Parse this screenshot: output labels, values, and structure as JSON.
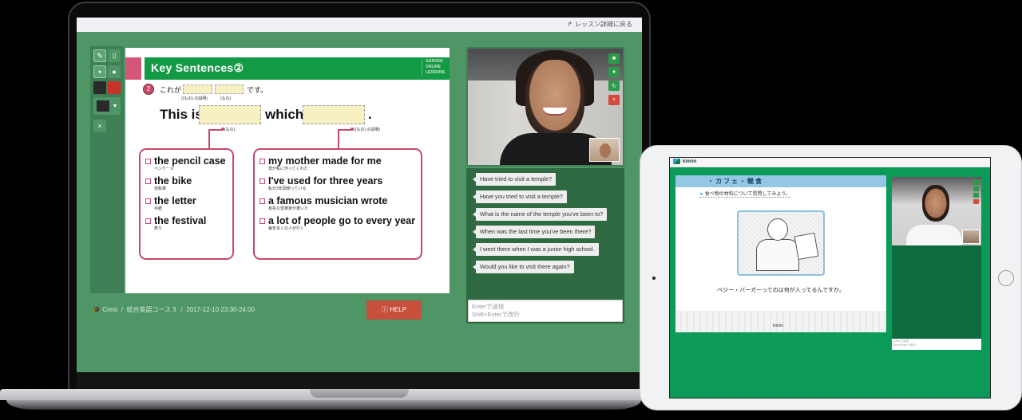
{
  "laptop": {
    "topbar": {
      "back_icon": "share-arrow-icon",
      "back_link": "レッスン詳細に戻る"
    },
    "palette": {
      "tools": [
        {
          "name": "pen",
          "icon": "pencil-icon",
          "active": true
        },
        {
          "name": "stamp",
          "icon": "stamp-icon",
          "active": false
        },
        {
          "name": "drop-small",
          "icon": "drop-small-icon",
          "active": true
        },
        {
          "name": "drop-large",
          "icon": "drop-large-icon",
          "active": false
        },
        {
          "name": "color-black",
          "color": "#2a2a2a"
        },
        {
          "name": "color-red",
          "color": "#c8322b"
        },
        {
          "name": "color-dropdown",
          "color": "#2a2a2a"
        },
        {
          "name": "clear",
          "icon": "close-icon",
          "label": "×"
        }
      ]
    },
    "slide": {
      "title": "Key Sentences②",
      "brand_logo": [
        "GAKKEN",
        "ONLINE",
        "LESSONS"
      ],
      "question_number": "2",
      "jp_prefix": "これが",
      "jp_suffix": "です。",
      "jp_hint_1": "((もの) の説明)",
      "jp_hint_2": "(もの)",
      "en_prefix": "This is",
      "en_middle": "which",
      "en_suffix": ".",
      "connector_hint_1": "(もの)",
      "connector_hint_2": "((もの) の説明)",
      "left_choices": [
        {
          "en": "the pencil case",
          "jp": "ペンケース"
        },
        {
          "en": "the bike",
          "jp": "自転車"
        },
        {
          "en": "the letter",
          "jp": "手紙"
        },
        {
          "en": "the festival",
          "jp": "祭り"
        }
      ],
      "right_choices": [
        {
          "en": "my mother made for me",
          "jp": "母が私に作ってくれた"
        },
        {
          "en": "I've used for three years",
          "jp": "私が3年間使っている"
        },
        {
          "en": "a famous musician wrote",
          "jp": "有名な音楽家が書いた"
        },
        {
          "en": "a lot of people go to every year",
          "jp": "毎年多くの人が行く"
        }
      ]
    },
    "breadcrumb": {
      "icon": "graduation-cap-icon",
      "items": [
        "Crest",
        "総合英語コース３",
        "2017-12-10 23:30-24:00"
      ],
      "separator": "/"
    },
    "help_button": {
      "icon": "info-circle-icon",
      "label": "HELP"
    },
    "video_controls": [
      {
        "name": "camera",
        "icon": "video-camera-icon",
        "color": "#2d9a4b"
      },
      {
        "name": "mic",
        "icon": "microphone-icon",
        "color": "#2d9a4b"
      },
      {
        "name": "switch",
        "icon": "refresh-icon",
        "color": "#2d9a4b"
      },
      {
        "name": "hangup",
        "icon": "close-icon",
        "color": "#d24b3c"
      }
    ],
    "chat": {
      "messages": [
        "Have tried to visit a temple?",
        "Have you tried to visit a temple?",
        "What is the name of the temple you've been to?",
        "When was the last time you've been there?",
        "I went there when I was a junior high school.",
        "Would you like to visit there again?"
      ],
      "input_placeholder": "Enterで送信\nShift+Enterで改行"
    }
  },
  "tablet": {
    "app_name": "kimini",
    "slide": {
      "title": "・カフェ・軽食",
      "subtitle": "食べ物の材料について質問してみよう。",
      "caption": "ベジー・バーガーってのは何が入ってるんですか。",
      "footer_logo": "kimini"
    },
    "chat_input_placeholder": "Enterで送信\nShift+Enterで改行"
  },
  "colors": {
    "laptop_bg": "#4f9667",
    "slide_header": "#139a44",
    "accent_pink": "#c84a6a",
    "help_red": "#c7503d",
    "tablet_bg": "#0b9a57"
  }
}
